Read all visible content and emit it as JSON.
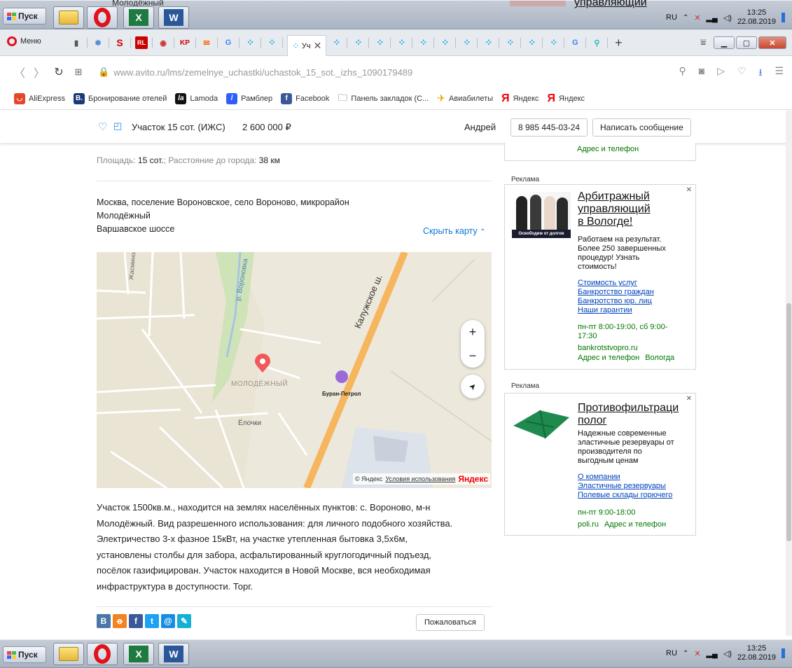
{
  "taskbar": {
    "start_label": "Пуск",
    "lang": "RU",
    "time": "13:25",
    "date": "22.08.2019",
    "top_partial_left": "Молодёжный",
    "top_partial_right": "управляющий"
  },
  "browser": {
    "menu_label": "Меню",
    "active_tab_label": "Уч",
    "url": "www.avito.ru/lms/zemelnye_uchastki/uchastok_15_sot._izhs_1090179489",
    "bookmarks": [
      "AliExpress",
      "Бронирование отелей",
      "Lamoda",
      "Рамблер",
      "Facebook",
      "Панель закладок (С...",
      "Авиабилеты",
      "Яндекс",
      "Яндекс"
    ]
  },
  "header": {
    "title": "Участок 15 сот. (ИЖС)",
    "price": "2 600 000 ₽",
    "seller": "Андрей",
    "phone": "8 985 445-03-24",
    "message_button": "Написать сообщение"
  },
  "details": {
    "area_label": "Площадь:",
    "area_value": "15 сот.",
    "distance_label": "; Расстояние до города:",
    "distance_value": "38 км"
  },
  "location": {
    "address_line1": "Москва, поселение Вороновское, село Вороново, микрорайон",
    "address_line2": "Молодёжный",
    "highway": "Варшавское шоссе",
    "hide_map": "Скрыть карту"
  },
  "map": {
    "labels": {
      "road": "Калужское ш.",
      "river": "р. Вороновка",
      "street": "Жасминов",
      "district": "МОЛОДЁЖНЫЙ",
      "gas_station": "Буран-Петрол",
      "area": "Ёлочки"
    },
    "zoom_in": "+",
    "zoom_out": "−",
    "copyright": "© Яндекс",
    "terms": "Условия использования",
    "brand": "Яндекс"
  },
  "description": [
    "Участок 1500кв.м., находится на землях населённых пунктов: с. Вороново, м-н",
    "Молодёжный. Вид разрешенного использования: для личного подобного хозяйства.",
    "Электричество 3-х фазное 15кВт, на участке утепленная бытовка 3,5х6м,",
    "установлены столбы для забора, асфальтированный круглогодичный подъезд,",
    "посёлок газифицирован. Участок находится в Новой Москве, вся необходимая",
    "инфраструктура в доступности. Торг."
  ],
  "share": {
    "report_button": "Пожаловаться"
  },
  "ads": {
    "partial_top": "Адрес и телефон",
    "label": "Реклама",
    "ad1": {
      "title_lines": [
        "Арбитражный",
        "управляющий",
        "в Вологде!"
      ],
      "image_caption": "Освободим от долгов",
      "text": [
        "Работаем на результат.",
        "Более 250 завершенных",
        "процедур! Узнать",
        "стоимость!"
      ],
      "links": [
        "Стоимость услуг",
        "Банкротство граждан",
        "Банкротство юр. лиц",
        "Наши гарантии"
      ],
      "hours": [
        "пн-пт 8:00-19:00, сб 9:00-",
        "17:30"
      ],
      "domain": "bankrotstvopro.ru",
      "contacts": "Адрес и телефон",
      "city": "Вологда"
    },
    "ad2": {
      "title_lines": [
        "Противофильтраци",
        "полог"
      ],
      "text": [
        "Надежные современные",
        "эластичные резервуары от",
        "производителя по",
        "выгодным ценам"
      ],
      "links": [
        "О компании",
        "Эластичные резервуары",
        "Полевые склады горючего"
      ],
      "hours": "пн-пт 9:00-18:00",
      "domain": "poli.ru",
      "contacts": "Адрес и телефон"
    }
  },
  "colors": {
    "link_blue": "#0a76d6",
    "avito_blue": "#1e88e5",
    "map_pin": "#f2585a",
    "road_orange": "#f6b65e",
    "opera_red": "#e0121b"
  }
}
